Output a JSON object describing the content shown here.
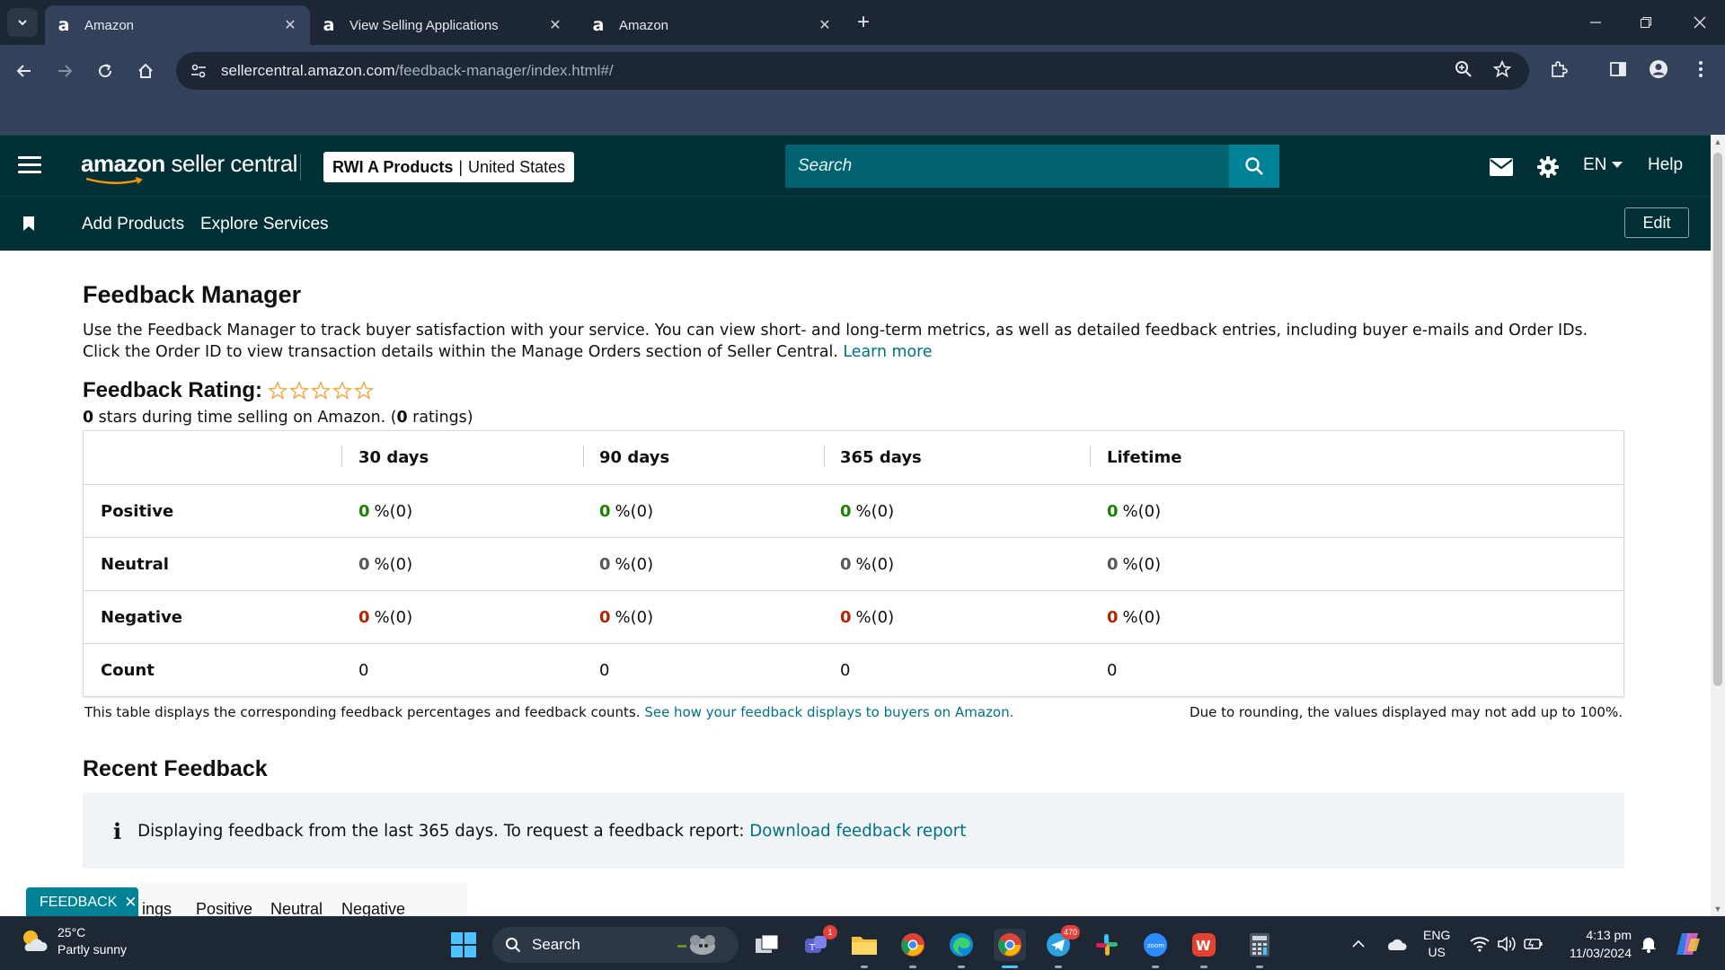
{
  "browser": {
    "tabs": [
      {
        "title": "Amazon",
        "active": true
      },
      {
        "title": "View Selling Applications",
        "active": false
      },
      {
        "title": "Amazon",
        "active": false
      }
    ],
    "url_domain": "sellercentral.amazon.com",
    "url_path": "/feedback-manager/index.html#/"
  },
  "header": {
    "logo_main": "amazon",
    "logo_sub": "seller central",
    "account_name": "RWI A Products",
    "account_separator": "|",
    "account_region": "United States",
    "search_placeholder": "Search",
    "language": "EN",
    "help": "Help"
  },
  "subnav": {
    "items": [
      "Add Products",
      "Explore Services"
    ],
    "edit": "Edit"
  },
  "page": {
    "title": "Feedback Manager",
    "intro": "Use the Feedback Manager to track buyer satisfaction with your service. You can view short- and long-term metrics, as well as detailed feedback entries, including buyer e-mails and Order IDs. Click the Order ID to view transaction details within the Manage Orders section of Seller Central.",
    "learn_more": "Learn more",
    "rating_label": "Feedback Rating:",
    "rating_stars": 0,
    "rating_stars_max": 5,
    "rating_sub_stars": "0",
    "rating_sub_text1": " stars during time selling on Amazon. (",
    "rating_sub_count": "0",
    "rating_sub_text2": " ratings)"
  },
  "table": {
    "headers": [
      "",
      "30 days",
      "90 days",
      "365 days",
      "Lifetime"
    ],
    "rows": [
      {
        "label": "Positive",
        "cells": [
          {
            "n": "0",
            "p": "%(0)"
          },
          {
            "n": "0",
            "p": "%(0)"
          },
          {
            "n": "0",
            "p": "%(0)"
          },
          {
            "n": "0",
            "p": "%(0)"
          }
        ]
      },
      {
        "label": "Neutral",
        "cells": [
          {
            "n": "0",
            "p": "%(0)"
          },
          {
            "n": "0",
            "p": "%(0)"
          },
          {
            "n": "0",
            "p": "%(0)"
          },
          {
            "n": "0",
            "p": "%(0)"
          }
        ]
      },
      {
        "label": "Negative",
        "cells": [
          {
            "n": "0",
            "p": "%(0)"
          },
          {
            "n": "0",
            "p": "%(0)"
          },
          {
            "n": "0",
            "p": "%(0)"
          },
          {
            "n": "0",
            "p": "%(0)"
          }
        ]
      },
      {
        "label": "Count",
        "cells": [
          "0",
          "0",
          "0",
          "0"
        ]
      }
    ],
    "note": "This table displays the corresponding feedback percentages and feedback counts.",
    "note_link": "See how your feedback displays to buyers on Amazon.",
    "rounding_note": "Due to rounding, the values displayed may not add up to 100%."
  },
  "recent": {
    "title": "Recent Feedback",
    "info_text": "Displaying feedback from the last 365 days. To request a feedback report:",
    "info_link": "Download feedback report",
    "tabs": [
      "ings",
      "Positive",
      "Neutral",
      "Negative"
    ]
  },
  "feedback_tab": {
    "label": "FEEDBACK",
    "close": "✕"
  },
  "taskbar": {
    "weather_temp": "25°C",
    "weather_desc": "Partly sunny",
    "search": "Search",
    "teams_badge": "1",
    "telegram_badge": "470",
    "lang_top": "ENG",
    "lang_bottom": "US",
    "time": "4:13 pm",
    "date": "11/03/2024"
  },
  "colors": {
    "header_bg": "#002f36",
    "link": "#007185",
    "positive": "#1d8102",
    "negative": "#b12704",
    "star": "#f3a847"
  }
}
